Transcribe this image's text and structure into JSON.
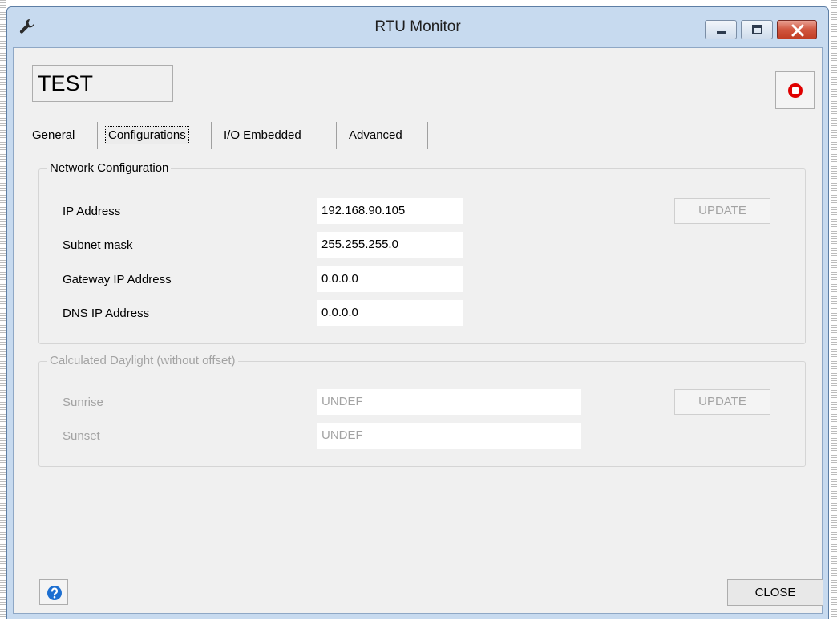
{
  "window": {
    "title": "RTU Monitor",
    "accent_color": "#d1563f",
    "icons": {
      "app": "wrench-icon",
      "minimize": "minimize-icon",
      "maximize": "maximize-icon",
      "close": "close-icon"
    }
  },
  "device": {
    "name": "TEST",
    "stop_icon": "stop-record-icon",
    "stop_color": "#e00000"
  },
  "tabs": [
    {
      "label": "General",
      "active": false
    },
    {
      "label": "Configurations",
      "active": true
    },
    {
      "label": "I/O Embedded",
      "active": false
    },
    {
      "label": "Advanced",
      "active": false
    }
  ],
  "network": {
    "title": "Network Configuration",
    "fields": [
      {
        "label": "IP Address",
        "value": "192.168.90.105"
      },
      {
        "label": "Subnet mask",
        "value": "255.255.255.0"
      },
      {
        "label": "Gateway IP Address",
        "value": "0.0.0.0"
      },
      {
        "label": "DNS IP Address",
        "value": "0.0.0.0"
      }
    ],
    "update_label": "UPDATE"
  },
  "daylight": {
    "title": "Calculated Daylight (without offset)",
    "fields": [
      {
        "label": "Sunrise",
        "value": "UNDEF"
      },
      {
        "label": "Sunset",
        "value": "UNDEF"
      }
    ],
    "update_label": "UPDATE",
    "disabled": true
  },
  "footer": {
    "help_icon": "help-icon",
    "close_label": "CLOSE"
  }
}
